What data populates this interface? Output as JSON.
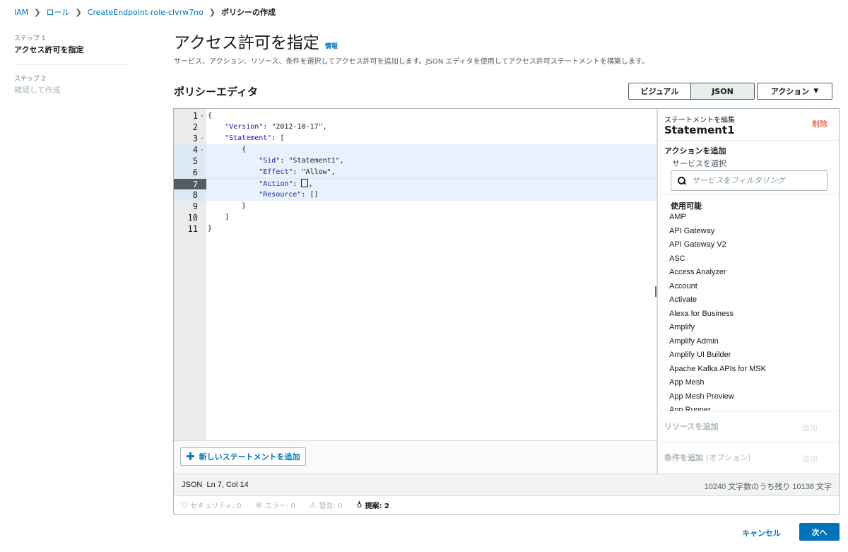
{
  "breadcrumb": {
    "items": [
      "IAM",
      "ロール",
      "CreateEndpoint-role-clvrw7no"
    ],
    "current": "ポリシーの作成",
    "separator": "❯"
  },
  "steps": [
    {
      "label": "ステップ 1",
      "title": "アクセス許可を指定"
    },
    {
      "label": "ステップ 2",
      "title": "確認して作成"
    }
  ],
  "header": {
    "title": "アクセス許可を指定",
    "info": "情報",
    "description": "サービス、アクション、リソース、条件を選択してアクセス許可を追加します。JSON エディタを使用してアクセス許可ステートメントを構築します。"
  },
  "editor": {
    "title": "ポリシーエディタ",
    "toggle_visual": "ビジュアル",
    "toggle_json": "JSON",
    "actions_label": "アクション",
    "actions_caret": "▼",
    "line_numbers": [
      "1",
      "2",
      "3",
      "4",
      "5",
      "6",
      "7",
      "8",
      "9",
      "10",
      "11"
    ],
    "code": {
      "l1": "{",
      "l2_key": "\"Version\"",
      "l2_rest": ": \"2012-10-17\",",
      "l3_key": "\"Statement\"",
      "l3_rest": ": [",
      "l4": "{",
      "l5_key": "\"Sid\"",
      "l5_rest": ": \"Statement1\",",
      "l6_key": "\"Effect\"",
      "l6_rest": ": \"Allow\",",
      "l7_key": "\"Action\"",
      "l7_mid": ": ",
      "l7_rest": ",",
      "l8_key": "\"Resource\"",
      "l8_rest": ": []",
      "l9": "}",
      "l10": "]",
      "l11": "}"
    },
    "add_statement": "新しいステートメントを追加",
    "add_statement_icon": "plus-icon"
  },
  "side_panel": {
    "edit_statement": "ステートメントを編集",
    "statement_name": "Statement1",
    "delete": "削除",
    "add_action": "アクションを追加",
    "select_service": "サービスを選択",
    "search_placeholder": "サービスをフィルタリング",
    "available": "使用可能",
    "services": [
      "AMP",
      "API Gateway",
      "API Gateway V2",
      "ASC",
      "Access Analyzer",
      "Account",
      "Activate",
      "Alexa for Business",
      "Amplify",
      "Amplify Admin",
      "Amplify UI Builder",
      "Apache Kafka APIs for MSK",
      "App Mesh",
      "App Mesh Preview",
      "App Runner"
    ],
    "add_resource": "リソースを追加",
    "add_resource_btn": "追加",
    "add_condition": "条件を追加",
    "add_condition_opt": "(オプション)",
    "add_condition_btn": "追加"
  },
  "status": {
    "mode": "JSON",
    "position": "Ln 7, Col 14",
    "remaining": "10240 文字数のうち残り 10138 文字"
  },
  "lint": {
    "security": "セキュリティ: 0",
    "errors": "エラー: 0",
    "warnings": "警告: 0",
    "suggestions": "提案: 2"
  },
  "footer": {
    "cancel": "キャンセル",
    "next": "次へ"
  },
  "colors": {
    "link": "#0073bb",
    "primary": "#0073bb",
    "danger": "#d13212"
  }
}
